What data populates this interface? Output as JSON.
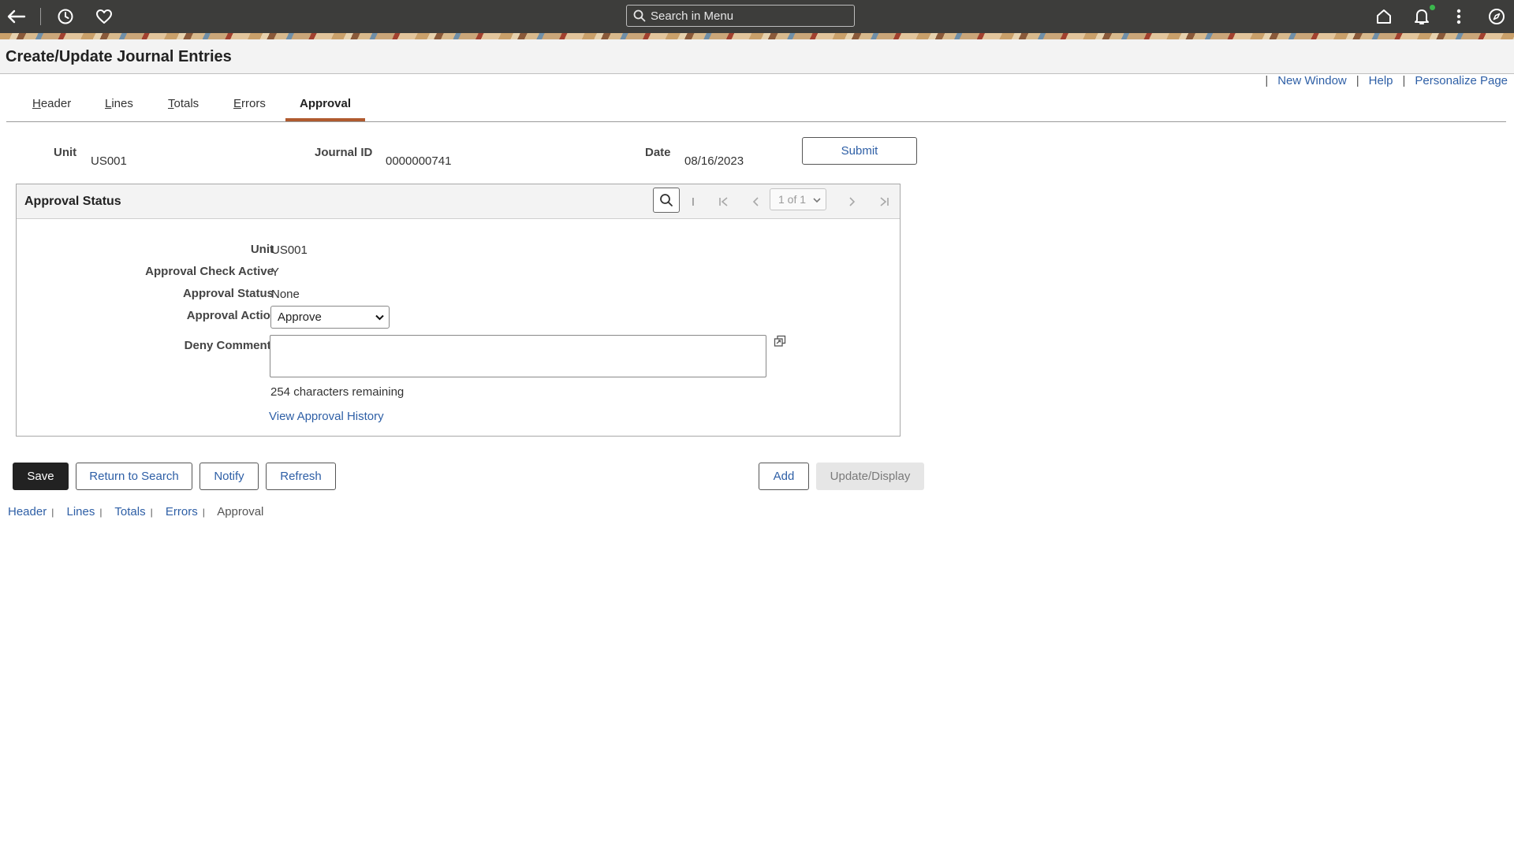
{
  "topbar": {
    "search_placeholder": "Search in Menu"
  },
  "page": {
    "title": "Create/Update Journal Entries"
  },
  "toplinks": {
    "pipe": "|",
    "new_window": "New Window",
    "help": "Help",
    "personalize": "Personalize Page"
  },
  "tabs": [
    {
      "label_underlined": "H",
      "label_rest": "eader"
    },
    {
      "label_underlined": "L",
      "label_rest": "ines"
    },
    {
      "label_underlined": "T",
      "label_rest": "otals"
    },
    {
      "label_underlined": "E",
      "label_rest": "rrors"
    },
    {
      "label": "Approval",
      "active": true
    }
  ],
  "header": {
    "unit_label": "Unit",
    "unit_value": "US001",
    "journal_id_label": "Journal ID",
    "journal_id_value": "0000000741",
    "date_label": "Date",
    "date_value": "08/16/2023",
    "submit_label": "Submit"
  },
  "panel": {
    "title": "Approval Status",
    "pager_separator": "I",
    "pager_value": "1 of 1",
    "unit_label": "Unit",
    "unit_value": "US001",
    "check_active_label": "Approval Check Active",
    "check_active_value": "Y",
    "status_label": "Approval Status",
    "status_value": "None",
    "action_label": "Approval Action",
    "action_value": "Approve",
    "deny_comments_label": "Deny Comments",
    "deny_comments_value": "",
    "chars_remaining": "254 characters remaining",
    "history_link": "View Approval History"
  },
  "buttons": {
    "save": "Save",
    "return_to_search": "Return to Search",
    "notify": "Notify",
    "refresh": "Refresh",
    "add": "Add",
    "update_display": "Update/Display"
  },
  "bottom_links": {
    "header": "Header",
    "lines": "Lines",
    "totals": "Totals",
    "errors": "Errors",
    "approval": "Approval",
    "pipe": "|"
  },
  "colors": {
    "topbar": "#3d3d3b",
    "accent_tab": "#b05a2f",
    "link": "#2e5fa6",
    "save_bg": "#222222"
  }
}
